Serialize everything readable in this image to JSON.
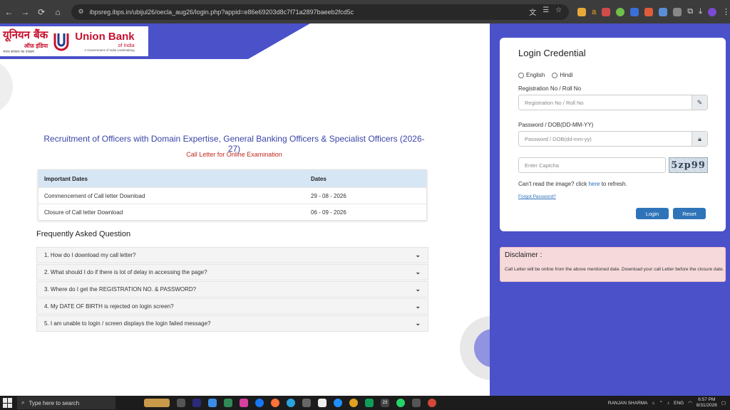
{
  "browser": {
    "url": "ibpsreg.ibps.in/ubijul26/oecla_aug26/login.php?appid=e86e69203d8c7f71a2897baeeb2fcd5c"
  },
  "logo": {
    "hindi_name": "यूनियन बैंक",
    "hindi_sub": "ऑफ़ इंडिया",
    "hindi_tagline": "भारत सरकार का उपक्रम",
    "english_name": "Union Bank",
    "english_sub": "of India",
    "english_tagline": "A Government of India Undertaking"
  },
  "main": {
    "title": "Recruitment of Officers with Domain Expertise, General Banking Officers & Specialist Officers (2026-27)",
    "subtitle": "Call Letter for Online Examination"
  },
  "dates_table": {
    "headers": [
      "Important Dates",
      "Dates"
    ],
    "rows": [
      {
        "event": "Commencement of Call letter Download",
        "date": "29 - 08 - 2026"
      },
      {
        "event": "Closure of Call letter Download",
        "date": "06 - 09 - 2026"
      }
    ]
  },
  "faq": {
    "title": "Frequently Asked Question",
    "items": [
      "1. How do I download my call letter?",
      "2. What should I do if there is lot of delay in accessing the page?",
      "3. Where do I get the REGISTRATION NO. & PASSWORD?",
      "4. My DATE OF BIRTH is rejected on login screen?",
      "5. I am unable to login / screen displays the login failed message?"
    ]
  },
  "login": {
    "title": "Login Credential",
    "lang_english": "English",
    "lang_hindi": "Hindi",
    "reg_label": "Registration No / Roll No",
    "reg_placeholder": "Registration No / Roll No",
    "pwd_label": "Password / DOB(DD-MM-YY)",
    "pwd_placeholder": "Password / DOB(dd-mm-yy)",
    "captcha_placeholder": "Enter Captcha",
    "captcha_text": "5zp99",
    "refresh_prefix": "Can't read the image? click ",
    "refresh_link": "here",
    "refresh_suffix": " to refresh.",
    "forgot": "Forgot Password?",
    "login_btn": "Login",
    "reset_btn": "Reset"
  },
  "disclaimer": {
    "title": "Disclaimer :",
    "text": "Call Letter will be online from the above mentioned date. Download your call Letter before the closure date."
  },
  "taskbar": {
    "search_placeholder": "Type here to search",
    "user": "RANJAN SHARMA",
    "lang": "ENG",
    "time": "6:57 PM",
    "date": "8/31/2026",
    "badge": "23"
  },
  "colors": {
    "brand_blue": "#4b51c9",
    "title_blue": "#3a44a8",
    "subtitle_red": "#c0281e",
    "button_blue": "#2f74b8",
    "disclaimer_pink": "#f6d9db"
  }
}
